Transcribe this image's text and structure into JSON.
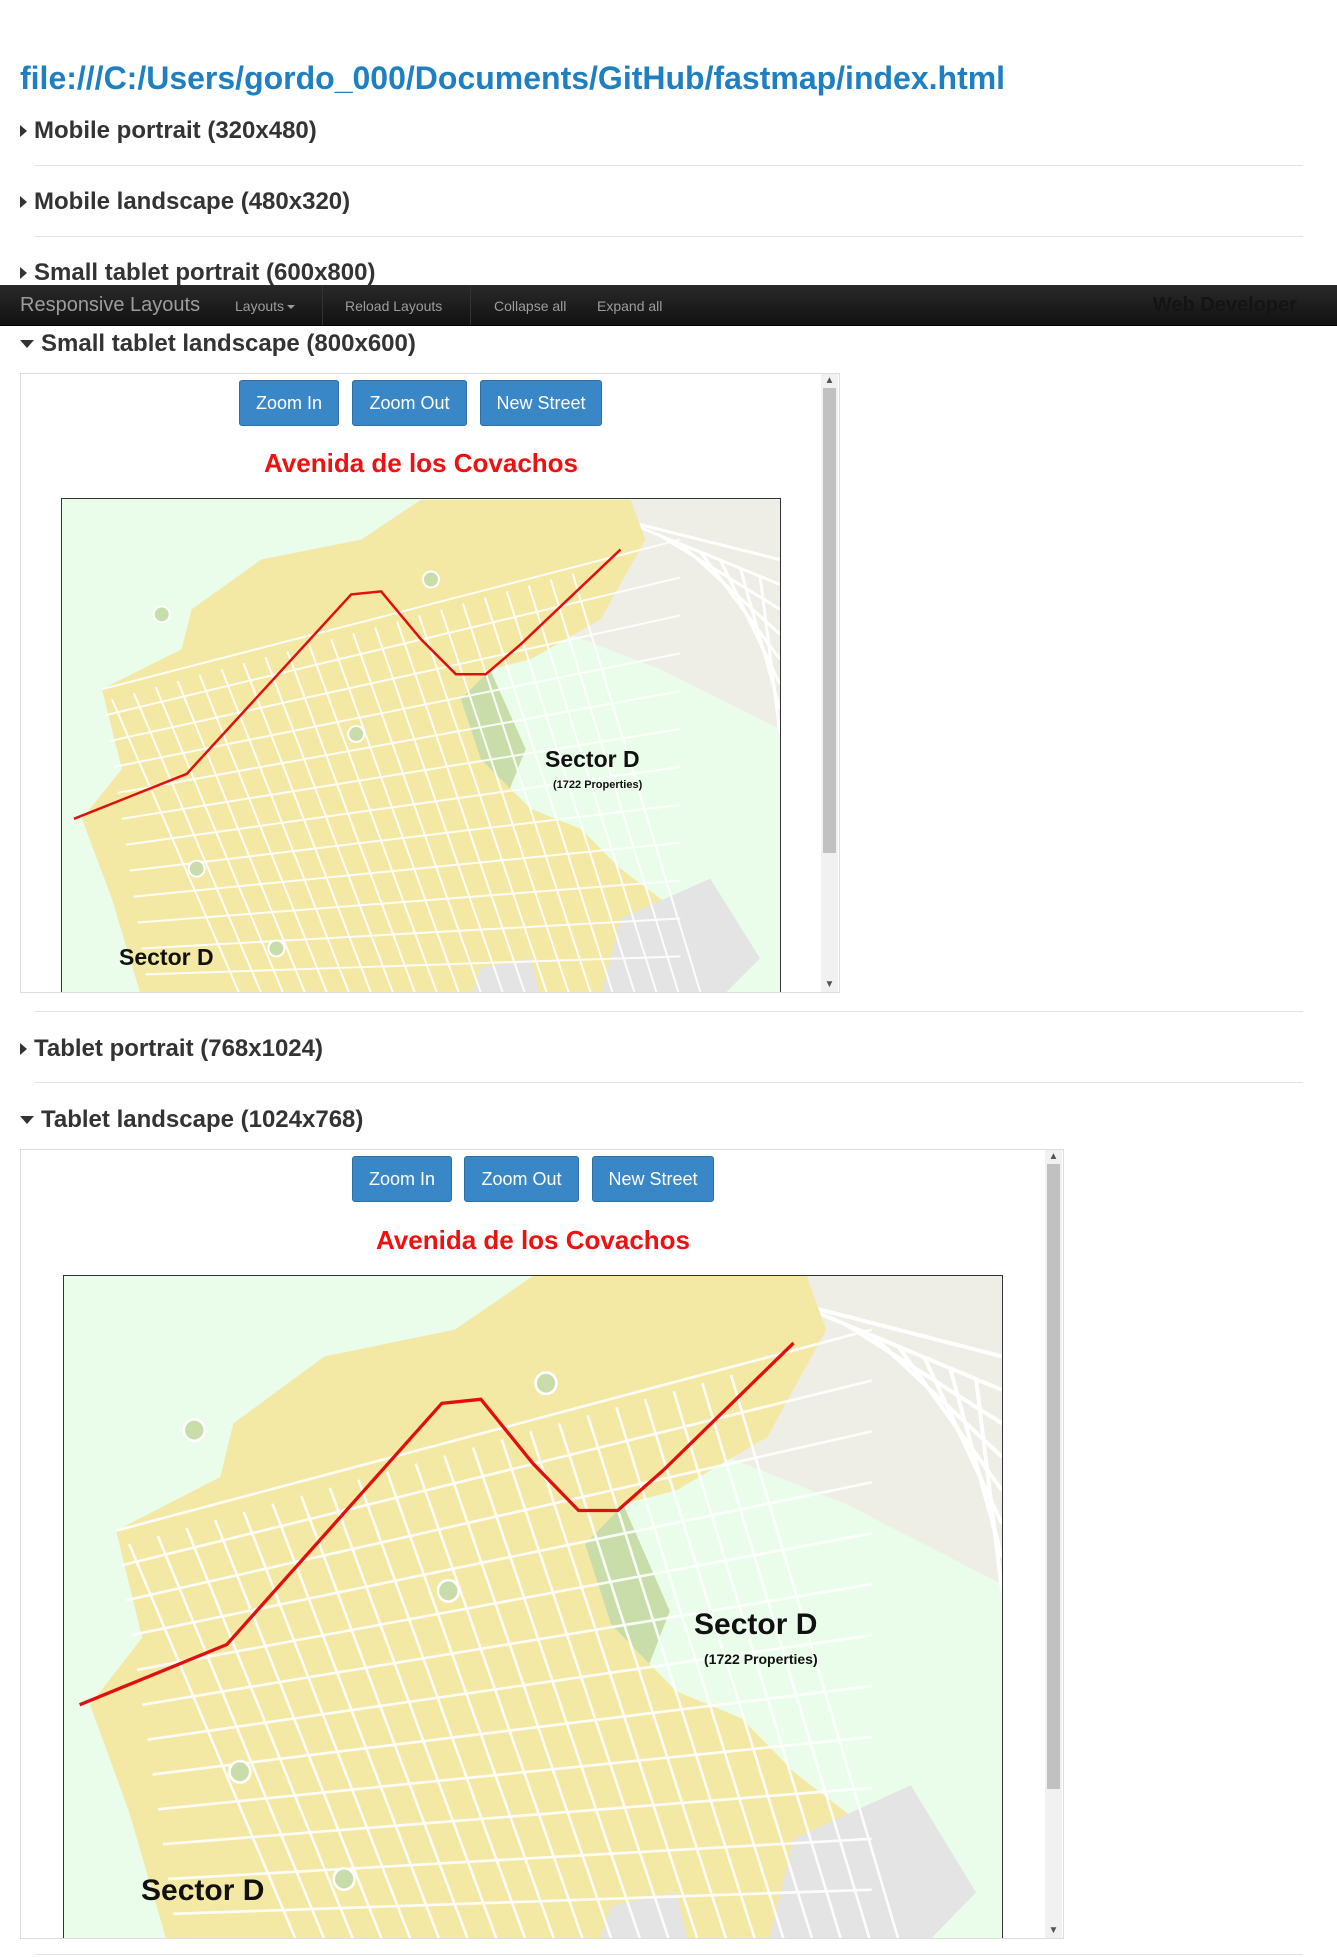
{
  "file_url": "file:///C:/Users/gordo_000/Documents/GitHub/fastmap/index.html",
  "sections": {
    "mobile_portrait": "Mobile portrait (320x480)",
    "mobile_landscape": "Mobile landscape (480x320)",
    "small_tablet_portrait": "Small tablet portrait (600x800)",
    "small_tablet_landscape": "Small tablet landscape (800x600)",
    "tablet_portrait": "Tablet portrait (768x1024)",
    "tablet_landscape": "Tablet landscape (1024x768)"
  },
  "toolbar": {
    "brand": "Responsive Layouts",
    "layouts": "Layouts",
    "reload": "Reload Layouts",
    "collapse_all": "Collapse all",
    "expand_all": "Expand all",
    "web_developer": "Web Developer"
  },
  "app": {
    "zoom_in": "Zoom In",
    "zoom_out": "Zoom Out",
    "new_street": "New Street",
    "street_name": "Avenida de los Covachos",
    "sector_label": "Sector D",
    "sector_properties": "(1722 Properties)",
    "sector_label_left": "Sector D"
  },
  "colors": {
    "street_title": "#ee1111",
    "button": "#3a87c8",
    "map_background": "#eafdea",
    "blocks": "#f3e8a4",
    "route": "#e01010",
    "link": "#1e7fc2"
  }
}
